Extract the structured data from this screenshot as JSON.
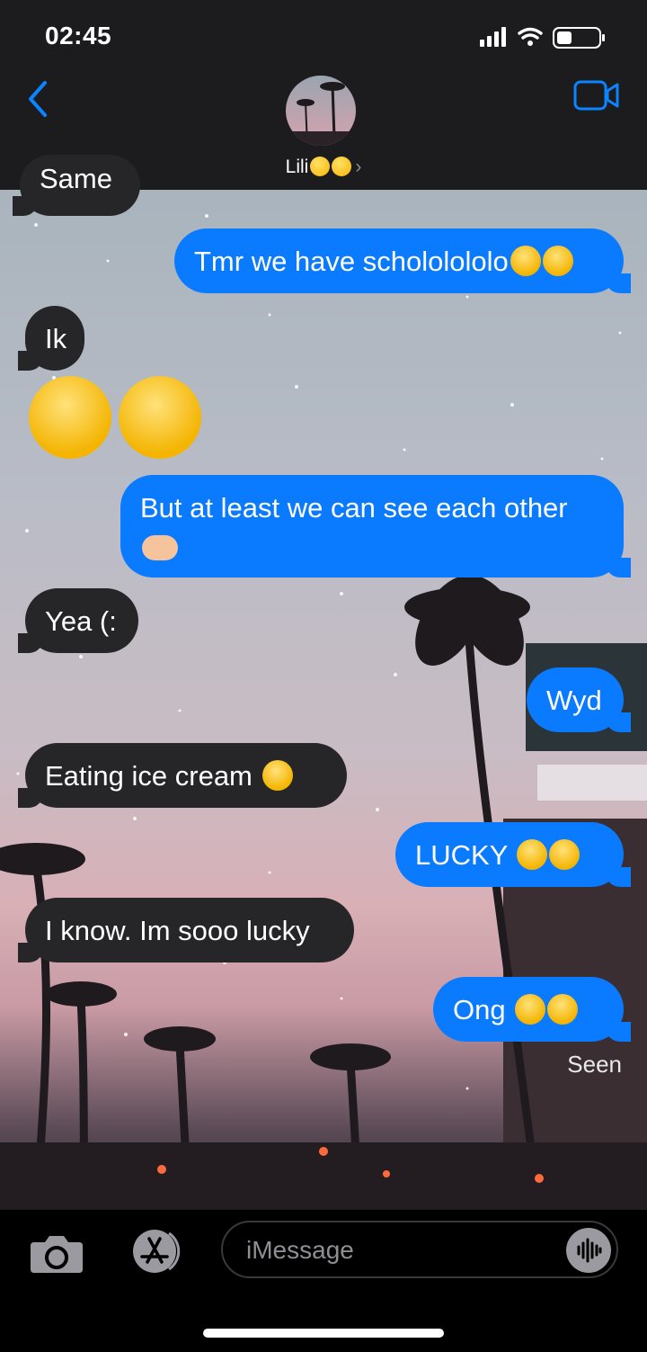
{
  "status": {
    "time": "02:45"
  },
  "header": {
    "contact_name": "Lili",
    "contact_emojis": [
      "heart-eyes-emoji",
      "grinning-emoji"
    ]
  },
  "messages": [
    {
      "side": "in",
      "text": "Same",
      "partial": true
    },
    {
      "side": "out",
      "text": "Tmr we have schololololo",
      "emojis": [
        "loudly-crying-emoji",
        "loudly-crying-emoji"
      ]
    },
    {
      "side": "in",
      "text": "Ik"
    },
    {
      "side": "in",
      "text": "",
      "emojis": [
        "loudly-crying-emoji",
        "loudly-crying-emoji"
      ],
      "jumbo": true
    },
    {
      "side": "out",
      "text": "But at least we can see each other",
      "emojis": [
        "heart-hands-emoji"
      ]
    },
    {
      "side": "in",
      "text": "Yea (:"
    },
    {
      "side": "out",
      "text": "Wyd"
    },
    {
      "side": "in",
      "text": "Eating ice cream",
      "emojis": [
        "sunglasses-emoji"
      ]
    },
    {
      "side": "out",
      "text": "LUCKY",
      "emojis": [
        "loudly-crying-emoji",
        "loudly-crying-emoji"
      ]
    },
    {
      "side": "in",
      "text": "I know. Im sooo lucky"
    },
    {
      "side": "out",
      "text": "Ong",
      "emojis": [
        "loudly-crying-emoji",
        "loudly-crying-emoji"
      ]
    }
  ],
  "receipt": "Seen",
  "composer": {
    "placeholder": "iMessage"
  },
  "colors": {
    "outgoing": "#0a7aff",
    "incoming": "#262628",
    "header": "#1c1c1e"
  }
}
